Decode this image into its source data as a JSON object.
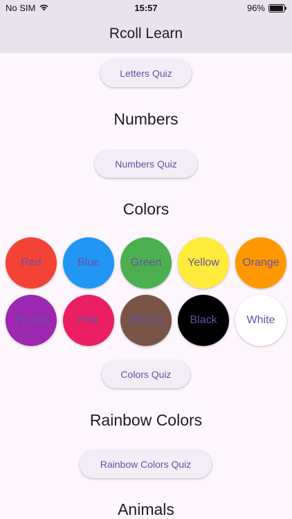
{
  "status": {
    "carrier": "No SIM",
    "time": "15:57",
    "battery": "96%",
    "battery_level": 0.96
  },
  "app": {
    "title": "Rcoll Learn"
  },
  "sections": {
    "letters": {
      "quiz_label": "Letters Quiz"
    },
    "numbers": {
      "title": "Numbers",
      "quiz_label": "Numbers Quiz"
    },
    "colors": {
      "title": "Colors",
      "quiz_label": "Colors Quiz",
      "items": [
        {
          "label": "Red",
          "color": "#f44336"
        },
        {
          "label": "Blue",
          "color": "#2196f3"
        },
        {
          "label": "Green",
          "color": "#4caf50"
        },
        {
          "label": "Yellow",
          "color": "#ffeb3b"
        },
        {
          "label": "Orange",
          "color": "#ff9800"
        },
        {
          "label": "Purple",
          "color": "#9c27b0"
        },
        {
          "label": "Pink",
          "color": "#e91e63"
        },
        {
          "label": "Brown",
          "color": "#795548"
        },
        {
          "label": "Black",
          "color": "#000000"
        },
        {
          "label": "White",
          "color": "#ffffff"
        }
      ]
    },
    "rainbow": {
      "title": "Rainbow Colors",
      "quiz_label": "Rainbow Colors Quiz"
    },
    "animals": {
      "title": "Animals"
    }
  }
}
